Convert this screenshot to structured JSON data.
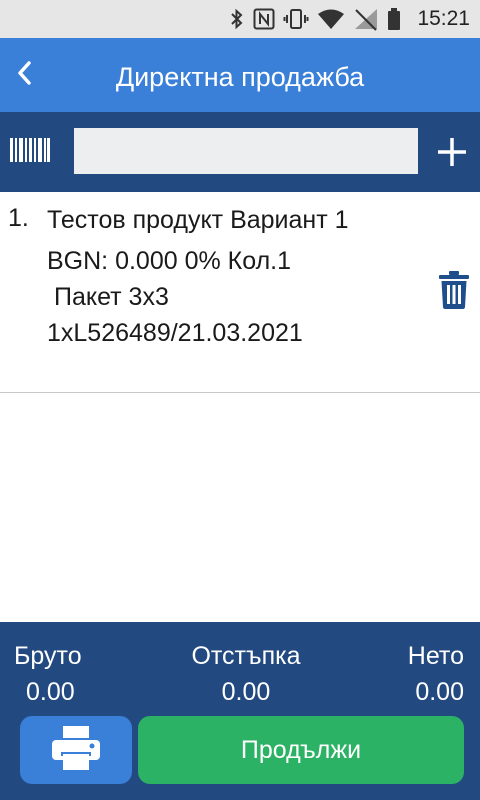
{
  "status_bar": {
    "time": "15:21",
    "icons": [
      "bluetooth-icon",
      "nfc-icon",
      "vibrate-icon",
      "wifi-icon",
      "no-signal-icon",
      "battery-icon"
    ]
  },
  "header": {
    "title": "Директна продажба",
    "back_icon": "chevron-left-icon"
  },
  "search": {
    "value": "",
    "barcode_icon": "barcode-icon",
    "add_icon": "plus-icon"
  },
  "items": [
    {
      "index": "1.",
      "name": "Тестов продукт Вариант 1",
      "price_line": "BGN: 0.000 0% Кол.1",
      "package": "Пакет 3x3",
      "lot": "1xL526489/21.03.2021",
      "delete_icon": "trash-icon"
    }
  ],
  "totals": {
    "gross_label": "Бруто",
    "gross_value": "0.00",
    "discount_label": "Отстъпка",
    "discount_value": "0.00",
    "net_label": "Нето",
    "net_value": "0.00"
  },
  "actions": {
    "print_icon": "printer-icon",
    "continue_label": "Продължи"
  },
  "colors": {
    "app_bar": "#3a7fd8",
    "dark_bar": "#234a80",
    "continue_button": "#2bb265",
    "icon_blue": "#1f4e8c"
  }
}
